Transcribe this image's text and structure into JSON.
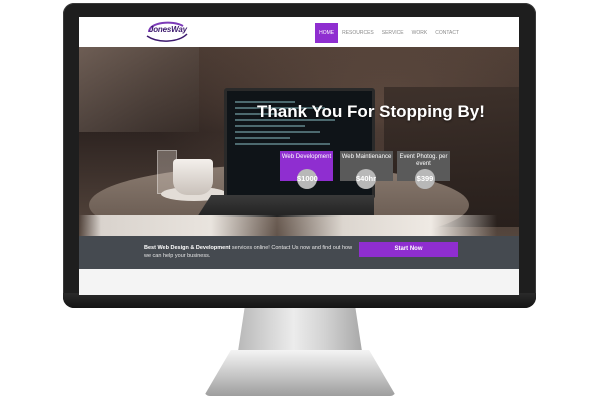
{
  "site": {
    "logo_text": "JonesWay",
    "logo_subtext": "Media"
  },
  "nav": {
    "items": [
      {
        "label": "HOME",
        "active": true
      },
      {
        "label": "RESOURCES",
        "active": false
      },
      {
        "label": "SERVICE",
        "active": false
      },
      {
        "label": "WORK",
        "active": false
      },
      {
        "label": "CONTACT",
        "active": false
      }
    ]
  },
  "hero": {
    "heading": "Thank You For Stopping By!",
    "services": [
      {
        "title": "Web Development",
        "price": "$1000",
        "color": "#8f2ed0"
      },
      {
        "title": "Web Maintienance",
        "price": "$40hr",
        "color": "#5a5a5a"
      },
      {
        "title": "Event Photog. per event",
        "price": "$399",
        "color": "#5a5a5a"
      }
    ]
  },
  "cta": {
    "bold_text": "Best Web Design & Development",
    "text": " services online! Contact Us now and find out how we can help your business.",
    "button_label": "Start Now"
  },
  "colors": {
    "accent": "#8f2ed0",
    "band": "#454a50"
  }
}
